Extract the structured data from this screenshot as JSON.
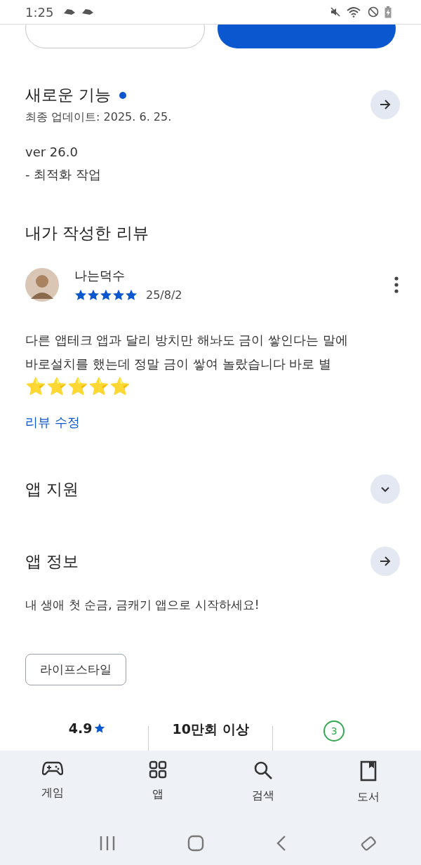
{
  "status_bar": {
    "time": "1:25"
  },
  "action_buttons": [
    {
      "kind": "outline"
    },
    {
      "kind": "filled"
    }
  ],
  "whats_new": {
    "title": "새로운 기능",
    "updated": "최종 업데이트: 2025. 6. 25.",
    "lines": [
      "ver 26.0",
      "- 최적화 작업"
    ]
  },
  "my_review": {
    "title": "내가 작성한 리뷰",
    "author": "나는덕수",
    "stars": 5,
    "date": "25/8/2",
    "text": "다른 앱테크 앱과 달리 방치만 해놔도 금이 쌓인다는 말에 바로설치를 했는데 정말 금이 쌓여 놀랐습니다 바로 별",
    "emoji": "⭐⭐⭐⭐⭐",
    "edit_link": "리뷰 수정"
  },
  "app_support": {
    "title": "앱 지원",
    "expanded": false
  },
  "app_info": {
    "title": "앱 정보",
    "description": "내 생애 첫 순금, 금캐기 앱으로 시작하세요!",
    "category": "라이프스타일"
  },
  "stats": [
    {
      "kind": "rating",
      "value": "4.9"
    },
    {
      "kind": "text",
      "value": "10만회 이상"
    },
    {
      "kind": "age",
      "value": "3"
    }
  ],
  "bottom_nav": [
    {
      "label": "게임",
      "selected": false
    },
    {
      "label": "앱",
      "selected": false
    },
    {
      "label": "검색",
      "selected": false
    },
    {
      "label": "도서",
      "selected": false
    }
  ]
}
